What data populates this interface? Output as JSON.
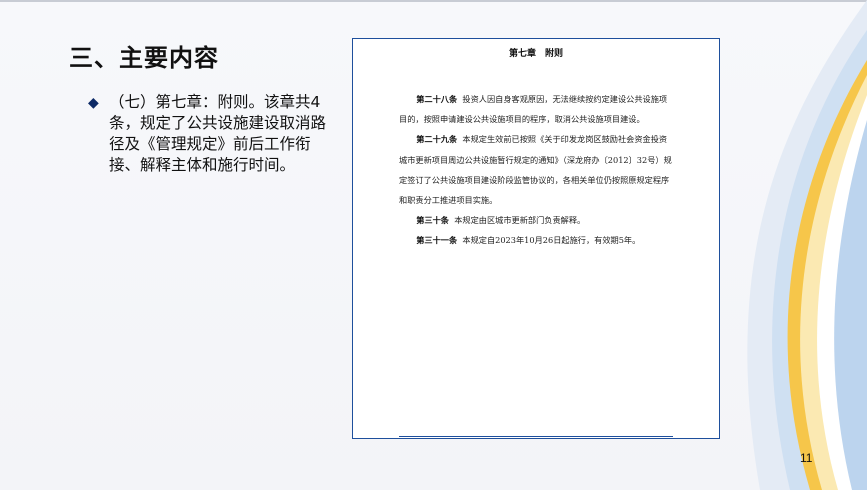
{
  "slide": {
    "title": "三、主要内容",
    "bullet_marker": "◆",
    "bullet_text": "（七）第七章：附则。该章共4条，规定了公共设施建设取消路径及《管理规定》前后工作衔接、解释主体和施行时间。",
    "page_number": "11"
  },
  "document": {
    "chapter_title": "第七章　附则",
    "articles": [
      {
        "head": "第二十八条",
        "text": "投资人因自身客观原因，无法继续按约定建设公共设施项目的，按照申请建设公共设施项目的程序，取消公共设施项目建设。"
      },
      {
        "head": "第二十九条",
        "text": "本规定生效前已按照《关于印发龙岗区鼓励社会资金投资城市更新项目周边公共设施暂行规定的通知》（深龙府办〔2012〕32号）规定签订了公共设施项目建设阶段监管协议的，各相关单位仍按照原规定程序和职责分工推进项目实施。"
      },
      {
        "head": "第三十条",
        "text": "本规定由区城市更新部门负责解释。"
      },
      {
        "head": "第三十一条",
        "text": "本规定自2023年10月26日起施行，有效期5年。"
      }
    ]
  },
  "colors": {
    "accent_blue": "#1e4f9c",
    "deco_yellow": "#f6c64a",
    "deco_light_blue": "#bcd4ee"
  }
}
